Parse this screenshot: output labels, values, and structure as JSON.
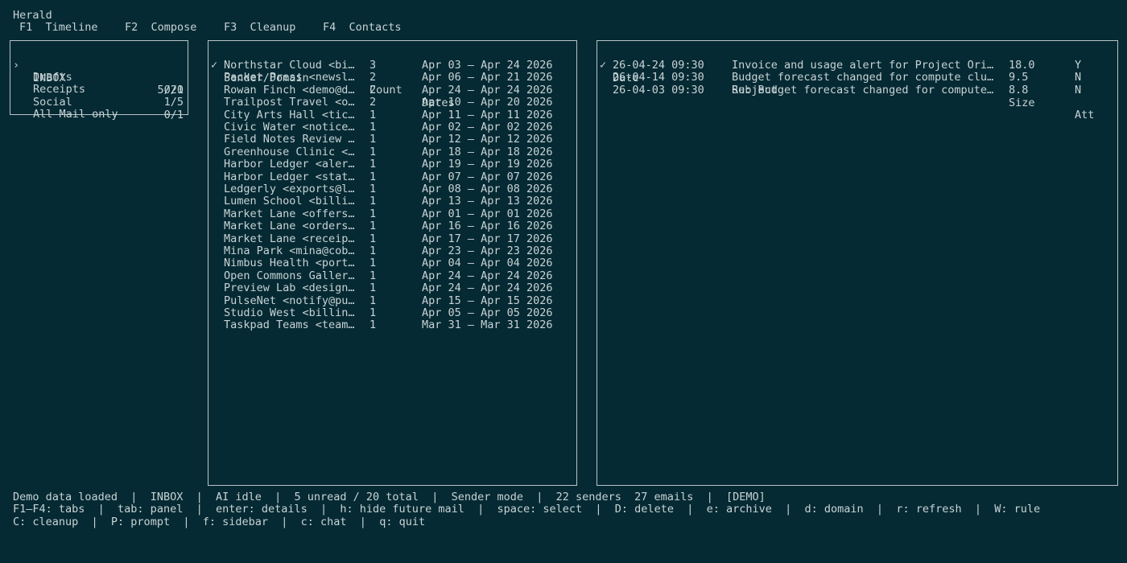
{
  "app": {
    "title": "Herald"
  },
  "tabs": [
    {
      "key": "F1",
      "label": "Timeline"
    },
    {
      "key": "F2",
      "label": "Compose"
    },
    {
      "key": "F3",
      "label": "Cleanup"
    },
    {
      "key": "F4",
      "label": "Contacts"
    }
  ],
  "folders": {
    "cursor": "›",
    "items": [
      {
        "name": "INBOX",
        "count": "5/20"
      },
      {
        "name": "Drafts",
        "count": "0/1"
      },
      {
        "name": "Receipts",
        "count": "1/5"
      },
      {
        "name": "Social",
        "count": "0/1"
      },
      {
        "name": "All Mail only",
        "count": ""
      }
    ]
  },
  "senders": {
    "check_header": "✓",
    "headers": {
      "sender": "Sender/Domain",
      "count": "Count",
      "dates": "Dates"
    },
    "rows": [
      {
        "sender": "Northstar Cloud <bi…",
        "count": "3",
        "dates": "Apr 03 – Apr 24 2026"
      },
      {
        "sender": "Packet Press <newsl…",
        "count": "2",
        "dates": "Apr 06 – Apr 21 2026"
      },
      {
        "sender": "Rowan Finch <demo@d…",
        "count": "2",
        "dates": "Apr 24 – Apr 24 2026"
      },
      {
        "sender": "Trailpost Travel <o…",
        "count": "2",
        "dates": "Apr 10 – Apr 20 2026"
      },
      {
        "sender": "City Arts Hall <tic…",
        "count": "1",
        "dates": "Apr 11 – Apr 11 2026"
      },
      {
        "sender": "Civic Water <notice…",
        "count": "1",
        "dates": "Apr 02 – Apr 02 2026"
      },
      {
        "sender": "Field Notes Review …",
        "count": "1",
        "dates": "Apr 12 – Apr 12 2026"
      },
      {
        "sender": "Greenhouse Clinic <…",
        "count": "1",
        "dates": "Apr 18 – Apr 18 2026"
      },
      {
        "sender": "Harbor Ledger <aler…",
        "count": "1",
        "dates": "Apr 19 – Apr 19 2026"
      },
      {
        "sender": "Harbor Ledger <stat…",
        "count": "1",
        "dates": "Apr 07 – Apr 07 2026"
      },
      {
        "sender": "Ledgerly <exports@l…",
        "count": "1",
        "dates": "Apr 08 – Apr 08 2026"
      },
      {
        "sender": "Lumen School <billi…",
        "count": "1",
        "dates": "Apr 13 – Apr 13 2026"
      },
      {
        "sender": "Market Lane <offers…",
        "count": "1",
        "dates": "Apr 01 – Apr 01 2026"
      },
      {
        "sender": "Market Lane <orders…",
        "count": "1",
        "dates": "Apr 16 – Apr 16 2026"
      },
      {
        "sender": "Market Lane <receip…",
        "count": "1",
        "dates": "Apr 17 – Apr 17 2026"
      },
      {
        "sender": "Mina Park <mina@cob…",
        "count": "1",
        "dates": "Apr 23 – Apr 23 2026"
      },
      {
        "sender": "Nimbus Health <port…",
        "count": "1",
        "dates": "Apr 04 – Apr 04 2026"
      },
      {
        "sender": "Open Commons Galler…",
        "count": "1",
        "dates": "Apr 24 – Apr 24 2026"
      },
      {
        "sender": "Preview Lab <design…",
        "count": "1",
        "dates": "Apr 24 – Apr 24 2026"
      },
      {
        "sender": "PulseNet <notify@pu…",
        "count": "1",
        "dates": "Apr 15 – Apr 15 2026"
      },
      {
        "sender": "Studio West <billin…",
        "count": "1",
        "dates": "Apr 05 – Apr 05 2026"
      },
      {
        "sender": "Taskpad Teams <team…",
        "count": "1",
        "dates": "Mar 31 – Mar 31 2026"
      }
    ]
  },
  "emails": {
    "check_header": "✓",
    "headers": {
      "date": "Date",
      "subject": "Subject",
      "size": "Size",
      "att": "Att"
    },
    "rows": [
      {
        "date": "26-04-24 09:30",
        "subject": "Invoice and usage alert for Project Ori…",
        "size": "18.0",
        "att": "Y"
      },
      {
        "date": "26-04-14 09:30",
        "subject": "Budget forecast changed for compute clu…",
        "size": "9.5",
        "att": "N"
      },
      {
        "date": "26-04-03 09:30",
        "subject": "Re: Budget forecast changed for compute…",
        "size": "8.8",
        "att": "N"
      }
    ]
  },
  "status": {
    "items": [
      "Demo data loaded",
      "INBOX",
      "AI idle",
      "5 unread / 20 total",
      "Sender mode",
      "22 senders  27 emails",
      "[DEMO]"
    ]
  },
  "help": {
    "line1": [
      "F1–F4: tabs",
      "tab: panel",
      "enter: details",
      "h: hide future mail",
      "space: select",
      "D: delete",
      "e: archive",
      "d: domain",
      "r: refresh",
      "W: rule"
    ],
    "line2": [
      "C: cleanup",
      "P: prompt",
      "f: sidebar",
      "c: chat",
      "q: quit"
    ]
  }
}
